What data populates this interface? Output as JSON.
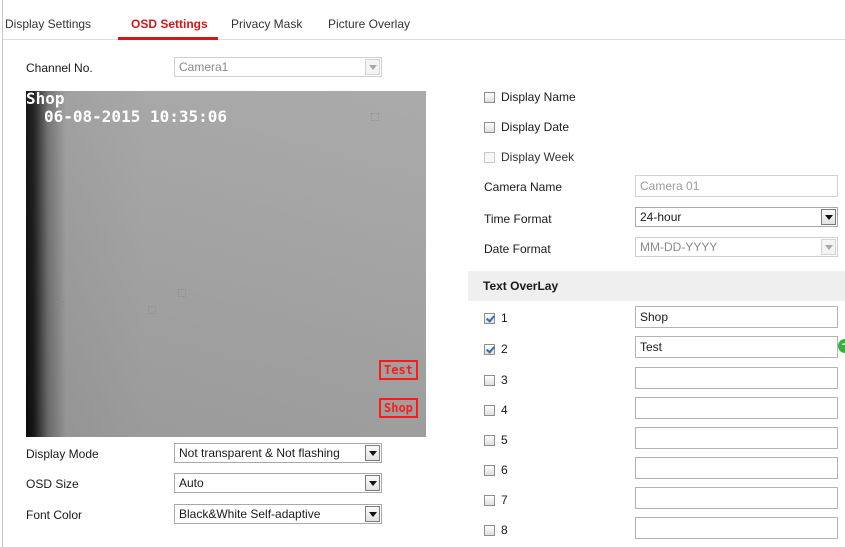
{
  "tabs": [
    {
      "label": "Display Settings",
      "active": false
    },
    {
      "label": "OSD Settings",
      "active": true
    },
    {
      "label": "Privacy Mask",
      "active": false
    },
    {
      "label": "Picture Overlay",
      "active": false
    }
  ],
  "channel": {
    "label": "Channel No.",
    "value": "Camera1"
  },
  "preview": {
    "name_overlay": "Shop",
    "datetime_overlay": "06-08-2015 10:35:06",
    "text_boxes": [
      "Test",
      "Shop"
    ]
  },
  "display_options": [
    {
      "label": "Display Name",
      "checked": false,
      "enabled": true
    },
    {
      "label": "Display Date",
      "checked": false,
      "enabled": true
    },
    {
      "label": "Display Week",
      "checked": false,
      "enabled": false
    }
  ],
  "camera_name": {
    "label": "Camera Name",
    "value": "Camera 01"
  },
  "time_format": {
    "label": "Time Format",
    "value": "24-hour"
  },
  "date_format": {
    "label": "Date Format",
    "value": "MM-DD-YYYY"
  },
  "text_overlay": {
    "title": "Text OverLay",
    "rows": [
      {
        "num": "1",
        "checked": true,
        "text": "Shop"
      },
      {
        "num": "2",
        "checked": true,
        "text": "Test"
      },
      {
        "num": "3",
        "checked": false,
        "text": ""
      },
      {
        "num": "4",
        "checked": false,
        "text": ""
      },
      {
        "num": "5",
        "checked": false,
        "text": ""
      },
      {
        "num": "6",
        "checked": false,
        "text": ""
      },
      {
        "num": "7",
        "checked": false,
        "text": ""
      },
      {
        "num": "8",
        "checked": false,
        "text": ""
      }
    ]
  },
  "display_mode": {
    "label": "Display Mode",
    "value": "Not transparent & Not flashing"
  },
  "osd_size": {
    "label": "OSD Size",
    "value": "Auto"
  },
  "font_color": {
    "label": "Font Color",
    "value": "Black&White Self-adaptive"
  },
  "colors": {
    "accent": "#d21717",
    "osd_box": "#ff1a1a",
    "add_button": "#3cae3c"
  },
  "icons": {
    "add": "plus-circle-icon",
    "dropdown": "chevron-down-icon"
  }
}
